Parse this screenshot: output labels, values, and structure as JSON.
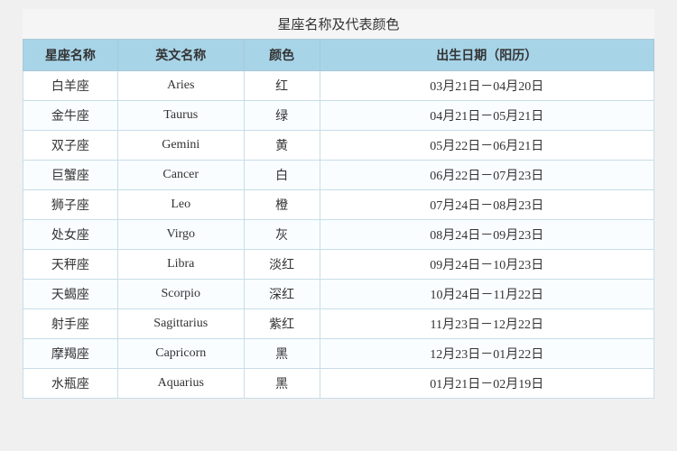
{
  "title": "星座名称及代表颜色",
  "headers": {
    "col1": "星座名称",
    "col2": "英文名称",
    "col3": "颜色",
    "col4": "出生日期（阳历）"
  },
  "rows": [
    {
      "cn": "白羊座",
      "en": "Aries",
      "color": "红",
      "date": "03月21日－04月20日"
    },
    {
      "cn": "金牛座",
      "en": "Taurus",
      "color": "绿",
      "date": "04月21日－05月21日"
    },
    {
      "cn": "双子座",
      "en": "Gemini",
      "color": "黄",
      "date": "05月22日－06月21日"
    },
    {
      "cn": "巨蟹座",
      "en": "Cancer",
      "color": "白",
      "date": "06月22日－07月23日"
    },
    {
      "cn": "狮子座",
      "en": "Leo",
      "color": "橙",
      "date": "07月24日－08月23日"
    },
    {
      "cn": "处女座",
      "en": "Virgo",
      "color": "灰",
      "date": "08月24日－09月23日"
    },
    {
      "cn": "天秤座",
      "en": "Libra",
      "color": "淡红",
      "date": "09月24日－10月23日"
    },
    {
      "cn": "天蝎座",
      "en": "Scorpio",
      "color": "深红",
      "date": "10月24日－11月22日"
    },
    {
      "cn": "射手座",
      "en": "Sagittarius",
      "color": "紫红",
      "date": "11月23日－12月22日"
    },
    {
      "cn": "摩羯座",
      "en": "Capricorn",
      "color": "黑",
      "date": "12月23日－01月22日"
    },
    {
      "cn": "水瓶座",
      "en": "Aquarius",
      "color": "黑",
      "date": "01月21日－02月19日"
    }
  ]
}
